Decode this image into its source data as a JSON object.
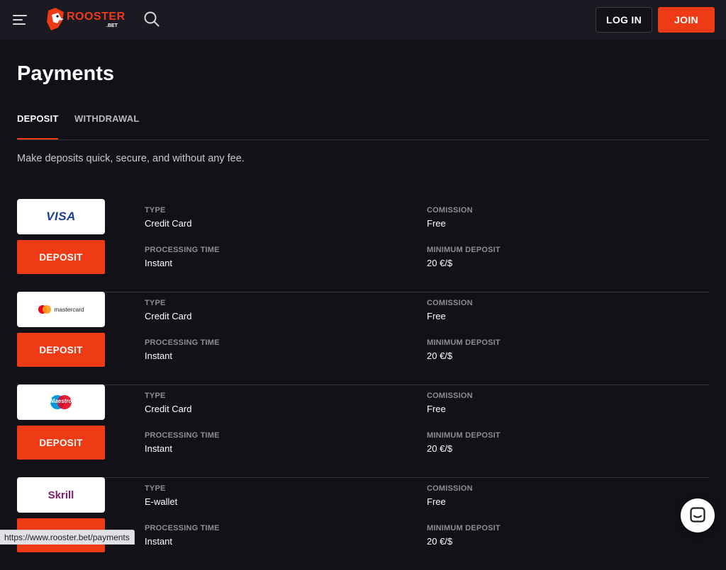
{
  "header": {
    "logo_text": "ROOSTER",
    "logo_sub": ".BET",
    "login_label": "LOG IN",
    "join_label": "JOIN"
  },
  "page": {
    "title": "Payments",
    "tabs": [
      {
        "label": "DEPOSIT",
        "active": true
      },
      {
        "label": "WITHDRAWAL",
        "active": false
      }
    ],
    "intro": "Make deposits quick, secure, and without any fee."
  },
  "labels": {
    "type": "TYPE",
    "comission": "COMISSION",
    "processing_time": "PROCESSING TIME",
    "minimum_deposit": "MINIMUM DEPOSIT",
    "deposit_button": "DEPOSIT"
  },
  "methods": [
    {
      "logo": "visa-logo",
      "brand": "VISA",
      "type": "Credit Card",
      "commission": "Free",
      "processing_time": "Instant",
      "minimum_deposit": "20 €/$"
    },
    {
      "logo": "mastercard-logo",
      "brand": "mastercard",
      "type": "Credit Card",
      "commission": "Free",
      "processing_time": "Instant",
      "minimum_deposit": "20 €/$"
    },
    {
      "logo": "maestro-logo",
      "brand": "Maestro",
      "type": "Credit Card",
      "commission": "Free",
      "processing_time": "Instant",
      "minimum_deposit": "20 €/$"
    },
    {
      "logo": "skrill-logo",
      "brand": "Skrill",
      "type": "E-wallet",
      "commission": "Free",
      "processing_time": "Instant",
      "minimum_deposit": "20 €/$"
    }
  ],
  "status_bar": {
    "url": "https://www.rooster.bet/payments"
  },
  "colors": {
    "background": "#121118",
    "header": "#1b1a22",
    "accent": "#ef3a16",
    "divider": "#34333c"
  },
  "icons": [
    "menu-icon",
    "search-icon",
    "rooster-logo-icon",
    "chat-icon"
  ]
}
